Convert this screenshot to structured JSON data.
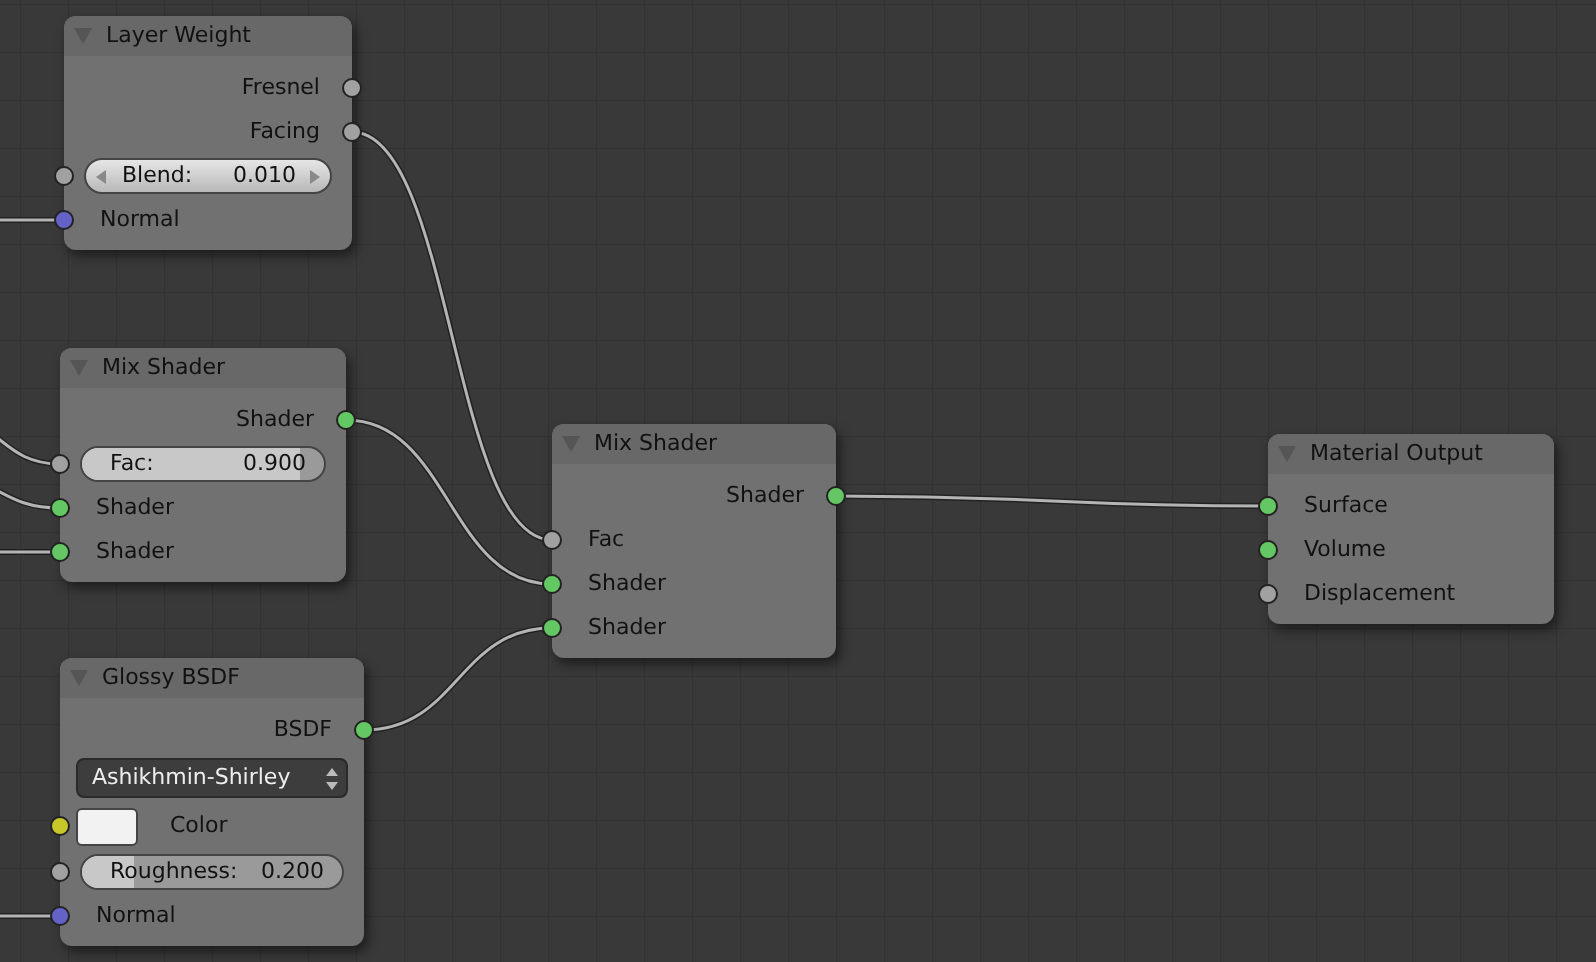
{
  "nodes": [
    {
      "title": "Layer Weight",
      "rows": [
        {
          "kind": "output",
          "label": "Fresnel",
          "color": "#a1a1a1"
        },
        {
          "kind": "output",
          "label": "Facing",
          "color": "#a1a1a1"
        },
        {
          "kind": "number",
          "label": "Blend:",
          "value": "0.010",
          "color": "#a1a1a1"
        },
        {
          "kind": "input",
          "label": "Normal",
          "color": "#6363c7"
        }
      ]
    },
    {
      "title": "Mix Shader",
      "rows": [
        {
          "kind": "output",
          "label": "Shader",
          "color": "#63c763"
        },
        {
          "kind": "slider",
          "label": "Fac:",
          "value": "0.900",
          "level": 0.9,
          "color": "#a1a1a1"
        },
        {
          "kind": "input",
          "label": "Shader",
          "color": "#63c763"
        },
        {
          "kind": "input",
          "label": "Shader",
          "color": "#63c763"
        }
      ]
    },
    {
      "title": "Glossy BSDF",
      "rows": [
        {
          "kind": "output",
          "label": "BSDF",
          "color": "#63c763"
        },
        {
          "kind": "dropdown",
          "value": "Ashikhmin-Shirley"
        },
        {
          "kind": "swatch",
          "label": "Color",
          "color": "#c7c729"
        },
        {
          "kind": "slider",
          "label": "Roughness:",
          "value": "0.200",
          "level": 0.2,
          "color": "#a1a1a1"
        },
        {
          "kind": "input",
          "label": "Normal",
          "color": "#6363c7"
        }
      ]
    },
    {
      "title": "Mix Shader",
      "rows": [
        {
          "kind": "output",
          "label": "Shader",
          "color": "#63c763"
        },
        {
          "kind": "input",
          "label": "Fac",
          "color": "#a1a1a1"
        },
        {
          "kind": "input",
          "label": "Shader",
          "color": "#63c763"
        },
        {
          "kind": "input",
          "label": "Shader",
          "color": "#63c763"
        }
      ]
    },
    {
      "title": "Material Output",
      "rows": [
        {
          "kind": "input",
          "label": "Surface",
          "color": "#63c763"
        },
        {
          "kind": "input",
          "label": "Volume",
          "color": "#63c763"
        },
        {
          "kind": "input",
          "label": "Displacement",
          "color": "#a1a1a1"
        }
      ]
    }
  ]
}
